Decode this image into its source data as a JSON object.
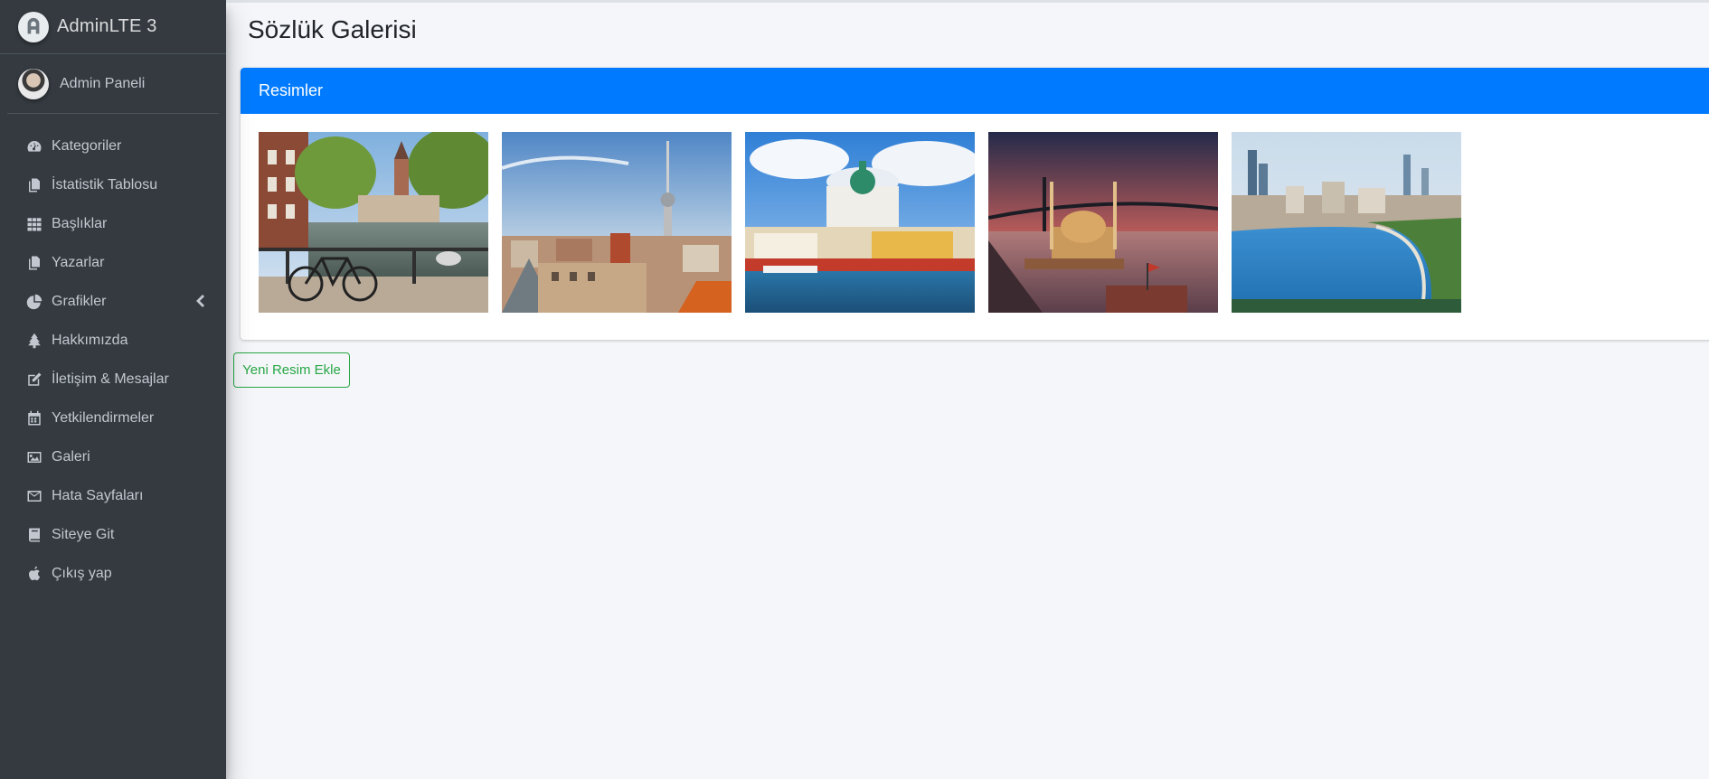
{
  "brand": {
    "name": "AdminLTE 3",
    "logo_icon": "adminlte-logo-icon"
  },
  "user": {
    "name": "Admin Paneli",
    "avatar": "user-avatar"
  },
  "nav": [
    {
      "label": "Kategoriler",
      "icon": "tachometer-icon"
    },
    {
      "label": "İstatistik Tablosu",
      "icon": "copy-icon"
    },
    {
      "label": "Başlıklar",
      "icon": "grid-icon"
    },
    {
      "label": "Yazarlar",
      "icon": "copy-icon"
    },
    {
      "label": "Grafikler",
      "icon": "pie-chart-icon",
      "caret": "chevron-left-icon"
    },
    {
      "label": "Hakkımızda",
      "icon": "tree-icon"
    },
    {
      "label": "İletişim & Mesajlar",
      "icon": "edit-icon"
    },
    {
      "label": "Yetkilendirmeler",
      "icon": "calendar-icon"
    },
    {
      "label": "Galeri",
      "icon": "image-icon"
    },
    {
      "label": "Hata Sayfaları",
      "icon": "envelope-icon"
    },
    {
      "label": "Siteye Git",
      "icon": "book-icon"
    },
    {
      "label": "Çıkış yap",
      "icon": "apple-icon"
    }
  ],
  "page": {
    "title": "Sözlük Galerisi"
  },
  "card": {
    "title": "Resimler"
  },
  "gallery": [
    {
      "subject": "amsterdam-canal-bicycle"
    },
    {
      "subject": "berlin-tv-tower"
    },
    {
      "subject": "helsinki-cathedral-harbor"
    },
    {
      "subject": "istanbul-ortakoy-mosque-bridge"
    },
    {
      "subject": "baku-boulevard-bay"
    }
  ],
  "actions": {
    "add_image": "Yeni Resim Ekle"
  },
  "colors": {
    "sidebar": "#343a40",
    "primary": "#007bff",
    "success": "#28a745",
    "content_bg": "#f4f6f9"
  }
}
